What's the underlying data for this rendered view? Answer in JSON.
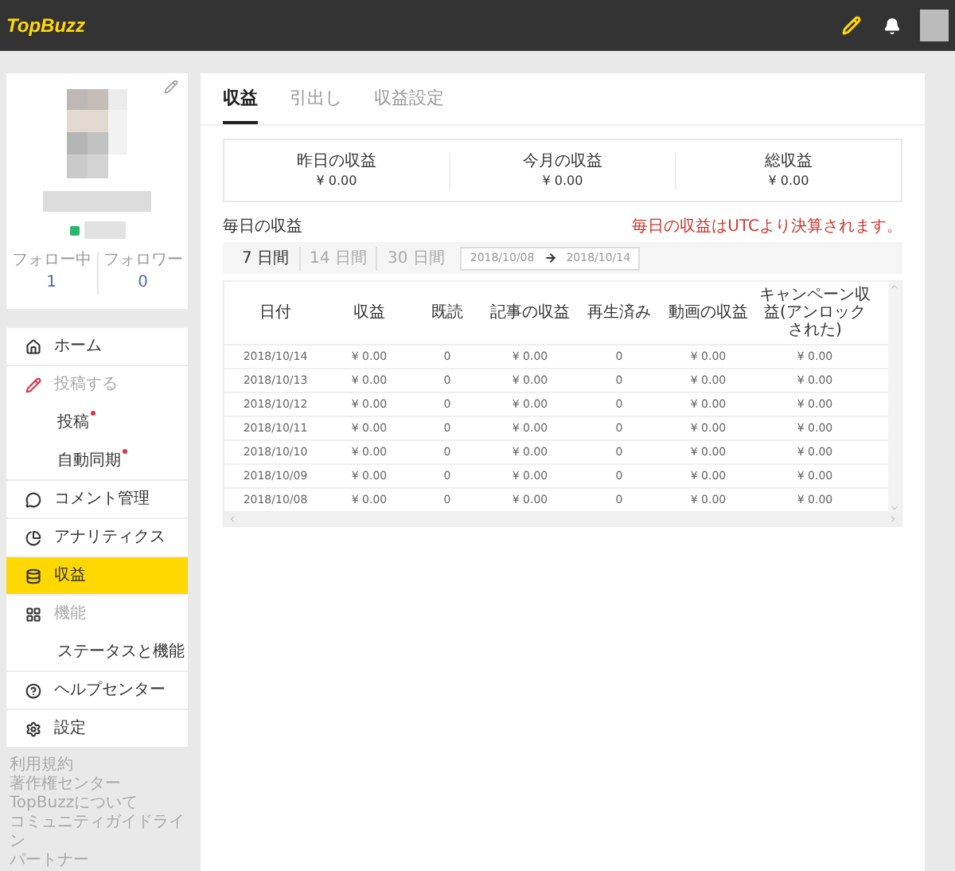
{
  "header": {
    "logo": "TopBuzz"
  },
  "profile": {
    "stats": [
      {
        "label": "フォロー中",
        "value": "1"
      },
      {
        "label": "フォロワー",
        "value": "0"
      }
    ]
  },
  "nav": [
    {
      "kind": "section",
      "label": "ホーム",
      "disabled": false,
      "selected": false
    },
    {
      "kind": "section",
      "label": "投稿する",
      "disabled": true,
      "selected": false
    },
    {
      "kind": "sub",
      "label": "投稿",
      "dot": true,
      "selected": false
    },
    {
      "kind": "sub",
      "label": "自動同期",
      "dot": true,
      "selected": false
    },
    {
      "kind": "section",
      "label": "コメント管理",
      "disabled": false,
      "selected": false
    },
    {
      "kind": "section",
      "label": "アナリティクス",
      "disabled": false,
      "selected": false
    },
    {
      "kind": "section",
      "label": "収益",
      "disabled": false,
      "selected": true
    },
    {
      "kind": "section",
      "label": "機能",
      "disabled": true,
      "selected": false
    },
    {
      "kind": "sub",
      "label": "ステータスと機能",
      "dot": false,
      "selected": false
    },
    {
      "kind": "section",
      "label": "ヘルプセンター",
      "disabled": false,
      "selected": false
    },
    {
      "kind": "section",
      "label": "設定",
      "disabled": false,
      "selected": false
    }
  ],
  "footer_links": [
    "利用規約",
    "著作権センター",
    "TopBuzzについて",
    "コミュニティガイドライン",
    "パートナー"
  ],
  "tabs": [
    {
      "label": "収益",
      "selected": true
    },
    {
      "label": "引出し",
      "selected": false
    },
    {
      "label": "収益設定",
      "selected": false
    }
  ],
  "summary": [
    {
      "label": "昨日の収益",
      "value": "¥ 0.00"
    },
    {
      "label": "今月の収益",
      "value": "¥ 0.00"
    },
    {
      "label": "総収益",
      "value": "¥ 0.00"
    }
  ],
  "daily": {
    "title": "毎日の収益",
    "note": "毎日の収益はUTCより決算されます。",
    "ranges": [
      {
        "label": "7 日間",
        "selected": true
      },
      {
        "label": "14 日間",
        "selected": false
      },
      {
        "label": "30 日間",
        "selected": false
      }
    ],
    "date_from": "2018/10/08",
    "date_to": "2018/10/14"
  },
  "table": {
    "columns": [
      "日付",
      "収益",
      "既読",
      "記事の収益",
      "再生済み",
      "動画の収益",
      "キャンペーン収益(アンロックされた)"
    ],
    "rows": [
      [
        "2018/10/14",
        "¥ 0.00",
        "0",
        "¥ 0.00",
        "0",
        "¥ 0.00",
        "¥ 0.00"
      ],
      [
        "2018/10/13",
        "¥ 0.00",
        "0",
        "¥ 0.00",
        "0",
        "¥ 0.00",
        "¥ 0.00"
      ],
      [
        "2018/10/12",
        "¥ 0.00",
        "0",
        "¥ 0.00",
        "0",
        "¥ 0.00",
        "¥ 0.00"
      ],
      [
        "2018/10/11",
        "¥ 0.00",
        "0",
        "¥ 0.00",
        "0",
        "¥ 0.00",
        "¥ 0.00"
      ],
      [
        "2018/10/10",
        "¥ 0.00",
        "0",
        "¥ 0.00",
        "0",
        "¥ 0.00",
        "¥ 0.00"
      ],
      [
        "2018/10/09",
        "¥ 0.00",
        "0",
        "¥ 0.00",
        "0",
        "¥ 0.00",
        "¥ 0.00"
      ],
      [
        "2018/10/08",
        "¥ 0.00",
        "0",
        "¥ 0.00",
        "0",
        "¥ 0.00",
        "¥ 0.00"
      ]
    ]
  }
}
